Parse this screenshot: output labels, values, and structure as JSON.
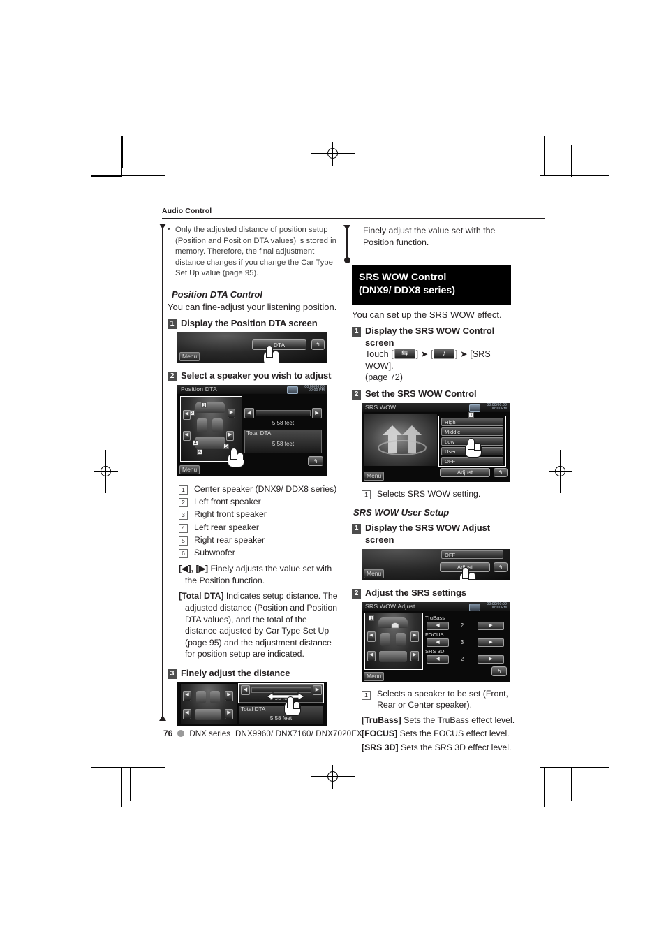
{
  "page": {
    "running_head": "Audio Control",
    "footer": {
      "number": "76",
      "series": "DNX series",
      "models": "DNX9960/ DNX7160/ DNX7020EX"
    }
  },
  "left_column": {
    "note": "Only the adjusted distance of position setup (Position and Position DTA values) is stored in memory. Therefore, the final adjustment distance changes if you change the Car Type Set Up value (page 95).",
    "sub_head": "Position DTA Control",
    "intro": "You can fine-adjust your listening position.",
    "steps": [
      {
        "num": "1",
        "title": "Display the Position DTA screen"
      },
      {
        "num": "2",
        "title": "Select a speaker you wish to adjust"
      },
      {
        "num": "3",
        "title": "Finely adjust the distance"
      }
    ],
    "callouts": [
      {
        "num": "1",
        "text": "Center speaker (DNX9/ DDX8 series)"
      },
      {
        "num": "2",
        "text": "Left front speaker"
      },
      {
        "num": "3",
        "text": "Right front speaker"
      },
      {
        "num": "4",
        "text": "Left rear speaker"
      },
      {
        "num": "5",
        "text": "Right rear speaker"
      },
      {
        "num": "6",
        "text": "Subwoofer"
      }
    ],
    "defs": [
      {
        "term": "[◀], [▶]",
        "desc": " Finely adjusts the value set with the Position function."
      },
      {
        "term": "[Total DTA]",
        "desc": " Indicates setup distance. The adjusted distance (Position and Position DTA values), and the total of the distance adjusted by Car Type Set Up (page 95) and the adjustment distance for position setup are indicated."
      }
    ],
    "screen_dta": {
      "button_label": "DTA",
      "menu_label": "Menu"
    },
    "screen_position_dta": {
      "title": "Position DTA",
      "menu_label": "Menu",
      "clock": "00:00/00:00",
      "clock2": "00:00 PM",
      "value": "5.58 feet",
      "total_label": "Total DTA",
      "total_value": "5.58 feet",
      "markers": [
        "1",
        "2",
        "3",
        "4",
        "5",
        "6"
      ]
    },
    "screen_fine": {
      "value": "5.58 feet",
      "total_label": "Total DTA",
      "total_value": "5.58 feet"
    }
  },
  "right_column": {
    "top_note": "Finely adjust the value set with the Position function.",
    "section_header_line1": "SRS WOW Control",
    "section_header_line2": "(DNX9/ DDX8 series)",
    "intro": "You can set up the SRS WOW effect.",
    "steps": [
      {
        "num": "1",
        "title": "Display the SRS WOW Control screen"
      },
      {
        "num": "2",
        "title": "Set the SRS WOW Control"
      }
    ],
    "touch_prefix": "Touch [",
    "touch_mid": "] ➤ [",
    "touch_suffix": "] ➤ [SRS WOW].",
    "touch_page": "(page 72)",
    "key1_glyph": "⇆",
    "key2_glyph": "♪",
    "callout_srs": {
      "num": "1",
      "text": "Selects SRS WOW setting."
    },
    "user_setup_head": "SRS WOW User Setup",
    "user_steps": [
      {
        "num": "1",
        "title": "Display the SRS WOW Adjust screen"
      },
      {
        "num": "2",
        "title": "Adjust the SRS settings"
      }
    ],
    "callout_adjust": {
      "num": "1",
      "text": "Selects a speaker to be set (Front, Rear or Center speaker)."
    },
    "defs": [
      {
        "term": "[TruBass]",
        "desc": " Sets the TruBass effect level."
      },
      {
        "term": "[FOCUS]",
        "desc": " Sets the FOCUS effect level."
      },
      {
        "term": "[SRS 3D]",
        "desc": " Sets the SRS 3D effect level."
      }
    ],
    "screen_srs_wow": {
      "title": "SRS WOW",
      "menu_label": "Menu",
      "clock": "00:00/00:00",
      "clock2": "00:00 PM",
      "marker": "1",
      "options": [
        "High",
        "Middle",
        "Low",
        "User",
        "OFF"
      ],
      "adjust_label": "Adjust"
    },
    "screen_adjust_entry": {
      "menu_label": "Menu",
      "off_label": "OFF",
      "adjust_label": "Adjust"
    },
    "screen_srs_adjust": {
      "title": "SRS WOW Adjust",
      "menu_label": "Menu",
      "clock": "00:00/00:00",
      "clock2": "00:00 PM",
      "marker": "1",
      "rows": [
        {
          "label": "TruBass",
          "value": "2"
        },
        {
          "label": "FOCUS",
          "value": "3"
        },
        {
          "label": "SRS 3D",
          "value": "2"
        }
      ]
    }
  },
  "colors": {
    "text": "#231f20",
    "note_text": "#3f3f3f",
    "step_badge": "#4d4d4d",
    "section_header_bg": "#000000",
    "footer_dot": "#9a9a9a"
  }
}
